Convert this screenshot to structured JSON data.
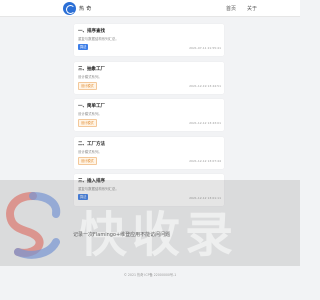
{
  "header": {
    "logo_text": "热 奇",
    "nav": [
      {
        "label": "首页"
      },
      {
        "label": "关于"
      }
    ]
  },
  "cards": [
    {
      "title": "一、排序查找",
      "desc": "重复与数据结构系列汇总。",
      "tag": "算法",
      "tag_style": "blue",
      "date": "2021-07-11 21:55:41"
    },
    {
      "title": "三、抽象工厂",
      "desc": "设计模式系列。",
      "tag": "设计模式",
      "tag_style": "orange",
      "date": "2021-12-19 13:44:51"
    },
    {
      "title": "一、简单工厂",
      "desc": "设计模式系列。",
      "tag": "设计模式",
      "tag_style": "orange",
      "date": "2021-12-12 13:43:01"
    },
    {
      "title": "二、工厂方法",
      "desc": "设计模式系列。",
      "tag": "设计模式",
      "tag_style": "orange",
      "date": "2021-12-12 13:07:44"
    },
    {
      "title": "三、插入排序",
      "desc": "重复与数据结构系列汇总。",
      "tag": "算法",
      "tag_style": "blue",
      "date": "2021-12-12 13:01:11"
    }
  ],
  "footer": {
    "text": "© 2021 热奇 ICP备 22000000号-1"
  },
  "watermark": {
    "text": "快收录",
    "caption": "记录一次Flamingo+维登应用不能访问问题"
  },
  "colors": {
    "accent": "#3d7ee8",
    "tag_orange": "#e08a2e",
    "background": "#f2f3f5"
  }
}
